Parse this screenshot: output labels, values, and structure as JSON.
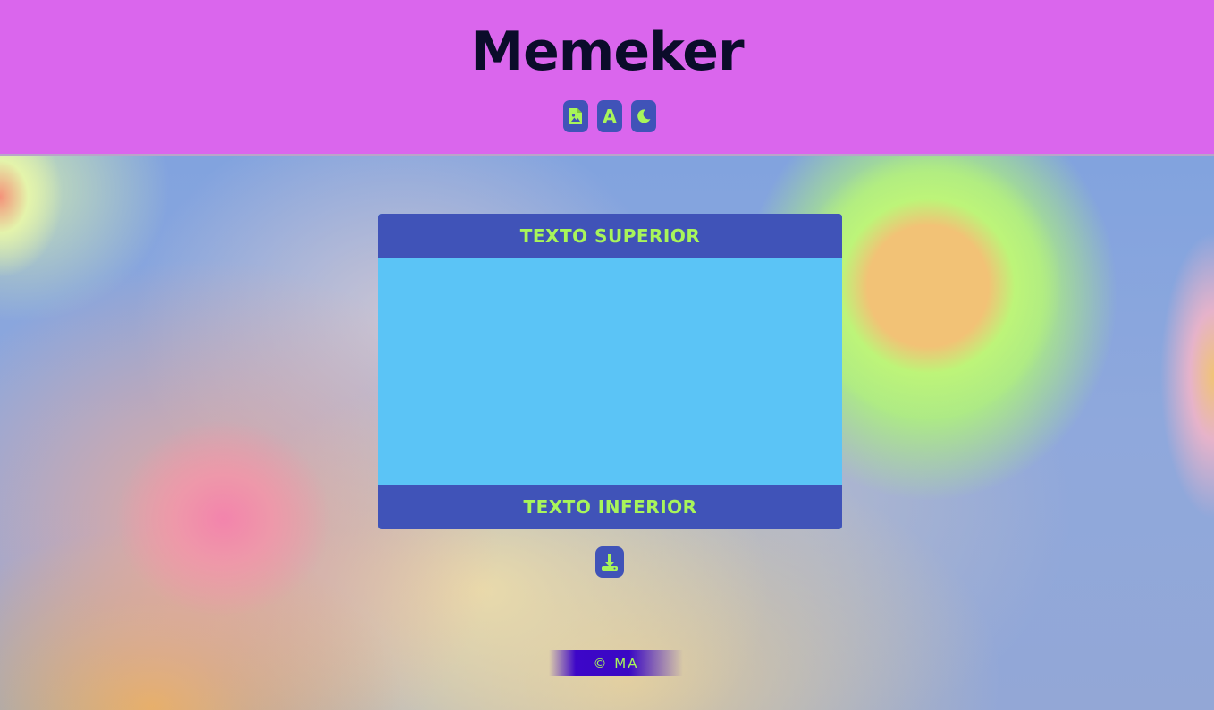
{
  "app": {
    "title": "Memeker"
  },
  "toolbar": {
    "buttons": [
      {
        "name": "image-panel",
        "icon": "file-image-icon"
      },
      {
        "name": "text-panel",
        "icon": "letter-a-icon",
        "glyph": "A"
      },
      {
        "name": "dark-mode",
        "icon": "moon-icon"
      }
    ]
  },
  "meme": {
    "top_text": "TEXTO SUPERIOR",
    "bottom_text": "TEXTO INFERIOR"
  },
  "actions": {
    "download_icon": "download-icon"
  },
  "footer": {
    "text": "© MA"
  },
  "colors": {
    "header_bg": "#da66ed",
    "title": "#0b0c2a",
    "button_bg": "#4053b8",
    "accent": "#a8f55a",
    "image_area": "#5bc4f6",
    "footer_bg": "#3d06c8"
  }
}
